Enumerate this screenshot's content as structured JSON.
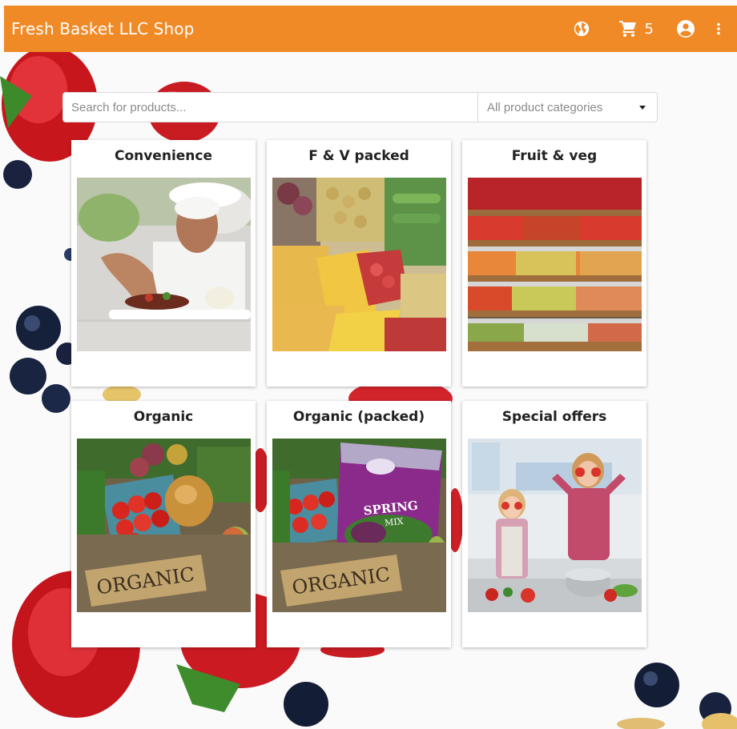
{
  "header": {
    "title": "Fresh Basket LLC Shop",
    "cart_count": "5",
    "icons": [
      "globe-icon",
      "cart-icon",
      "account-circle-icon",
      "more-vert-icon"
    ],
    "background_color": "#ef8a26"
  },
  "search": {
    "placeholder": "Search for products...",
    "value": "",
    "category_selected": "All product categories"
  },
  "categories": [
    {
      "title": "Convenience",
      "image": "chef-plating-dish"
    },
    {
      "title": "F & V packed",
      "image": "packed-fruit-and-vegetables"
    },
    {
      "title": "Fruit & veg",
      "image": "fruit-and-vegetable-market-stall"
    },
    {
      "title": "Organic",
      "image": "organic-vegetables-crates"
    },
    {
      "title": "Organic (packed)",
      "image": "organic-vegetables-with-bag"
    },
    {
      "title": "Special offers",
      "image": "mother-and-daughter-in-kitchen"
    }
  ],
  "organic_sign_text": "ORGANIC",
  "bag_label": {
    "line1": "SPRING",
    "line2": "MIX"
  }
}
